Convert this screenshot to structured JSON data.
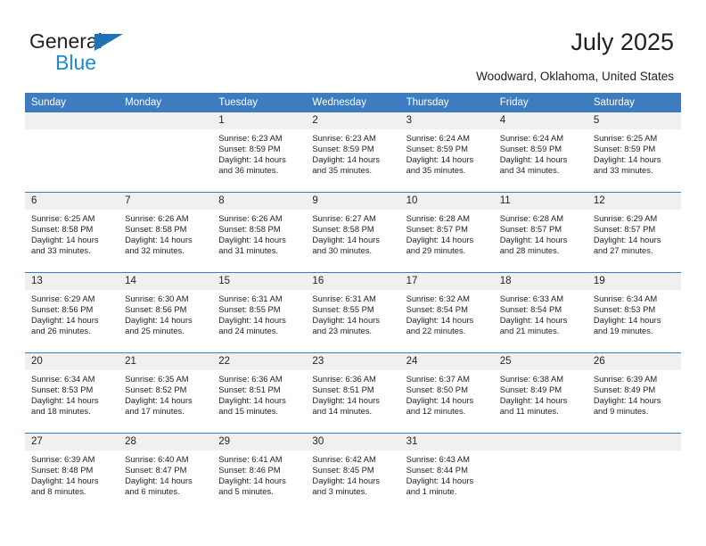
{
  "brand": {
    "line1": "General",
    "line2": "Blue",
    "triangle_icon": "brand-triangle-icon",
    "accent_color": "#1f8ad2"
  },
  "header": {
    "title": "July 2025",
    "subtitle": "Woodward, Oklahoma, United States"
  },
  "theme": {
    "header_row_bg": "#3d7cbf",
    "daynum_bg": "#f0f0f0",
    "text": "#231f20"
  },
  "weekday_headers": [
    "Sunday",
    "Monday",
    "Tuesday",
    "Wednesday",
    "Thursday",
    "Friday",
    "Saturday"
  ],
  "weeks": [
    [
      {
        "day": "",
        "empty": true,
        "sunrise": "",
        "sunset": "",
        "daylight_line1": "",
        "daylight_line2": ""
      },
      {
        "day": "",
        "empty": true,
        "sunrise": "",
        "sunset": "",
        "daylight_line1": "",
        "daylight_line2": ""
      },
      {
        "day": "1",
        "empty": false,
        "sunrise": "Sunrise: 6:23 AM",
        "sunset": "Sunset: 8:59 PM",
        "daylight_line1": "Daylight: 14 hours",
        "daylight_line2": "and 36 minutes."
      },
      {
        "day": "2",
        "empty": false,
        "sunrise": "Sunrise: 6:23 AM",
        "sunset": "Sunset: 8:59 PM",
        "daylight_line1": "Daylight: 14 hours",
        "daylight_line2": "and 35 minutes."
      },
      {
        "day": "3",
        "empty": false,
        "sunrise": "Sunrise: 6:24 AM",
        "sunset": "Sunset: 8:59 PM",
        "daylight_line1": "Daylight: 14 hours",
        "daylight_line2": "and 35 minutes."
      },
      {
        "day": "4",
        "empty": false,
        "sunrise": "Sunrise: 6:24 AM",
        "sunset": "Sunset: 8:59 PM",
        "daylight_line1": "Daylight: 14 hours",
        "daylight_line2": "and 34 minutes."
      },
      {
        "day": "5",
        "empty": false,
        "sunrise": "Sunrise: 6:25 AM",
        "sunset": "Sunset: 8:59 PM",
        "daylight_line1": "Daylight: 14 hours",
        "daylight_line2": "and 33 minutes."
      }
    ],
    [
      {
        "day": "6",
        "empty": false,
        "sunrise": "Sunrise: 6:25 AM",
        "sunset": "Sunset: 8:58 PM",
        "daylight_line1": "Daylight: 14 hours",
        "daylight_line2": "and 33 minutes."
      },
      {
        "day": "7",
        "empty": false,
        "sunrise": "Sunrise: 6:26 AM",
        "sunset": "Sunset: 8:58 PM",
        "daylight_line1": "Daylight: 14 hours",
        "daylight_line2": "and 32 minutes."
      },
      {
        "day": "8",
        "empty": false,
        "sunrise": "Sunrise: 6:26 AM",
        "sunset": "Sunset: 8:58 PM",
        "daylight_line1": "Daylight: 14 hours",
        "daylight_line2": "and 31 minutes."
      },
      {
        "day": "9",
        "empty": false,
        "sunrise": "Sunrise: 6:27 AM",
        "sunset": "Sunset: 8:58 PM",
        "daylight_line1": "Daylight: 14 hours",
        "daylight_line2": "and 30 minutes."
      },
      {
        "day": "10",
        "empty": false,
        "sunrise": "Sunrise: 6:28 AM",
        "sunset": "Sunset: 8:57 PM",
        "daylight_line1": "Daylight: 14 hours",
        "daylight_line2": "and 29 minutes."
      },
      {
        "day": "11",
        "empty": false,
        "sunrise": "Sunrise: 6:28 AM",
        "sunset": "Sunset: 8:57 PM",
        "daylight_line1": "Daylight: 14 hours",
        "daylight_line2": "and 28 minutes."
      },
      {
        "day": "12",
        "empty": false,
        "sunrise": "Sunrise: 6:29 AM",
        "sunset": "Sunset: 8:57 PM",
        "daylight_line1": "Daylight: 14 hours",
        "daylight_line2": "and 27 minutes."
      }
    ],
    [
      {
        "day": "13",
        "empty": false,
        "sunrise": "Sunrise: 6:29 AM",
        "sunset": "Sunset: 8:56 PM",
        "daylight_line1": "Daylight: 14 hours",
        "daylight_line2": "and 26 minutes."
      },
      {
        "day": "14",
        "empty": false,
        "sunrise": "Sunrise: 6:30 AM",
        "sunset": "Sunset: 8:56 PM",
        "daylight_line1": "Daylight: 14 hours",
        "daylight_line2": "and 25 minutes."
      },
      {
        "day": "15",
        "empty": false,
        "sunrise": "Sunrise: 6:31 AM",
        "sunset": "Sunset: 8:55 PM",
        "daylight_line1": "Daylight: 14 hours",
        "daylight_line2": "and 24 minutes."
      },
      {
        "day": "16",
        "empty": false,
        "sunrise": "Sunrise: 6:31 AM",
        "sunset": "Sunset: 8:55 PM",
        "daylight_line1": "Daylight: 14 hours",
        "daylight_line2": "and 23 minutes."
      },
      {
        "day": "17",
        "empty": false,
        "sunrise": "Sunrise: 6:32 AM",
        "sunset": "Sunset: 8:54 PM",
        "daylight_line1": "Daylight: 14 hours",
        "daylight_line2": "and 22 minutes."
      },
      {
        "day": "18",
        "empty": false,
        "sunrise": "Sunrise: 6:33 AM",
        "sunset": "Sunset: 8:54 PM",
        "daylight_line1": "Daylight: 14 hours",
        "daylight_line2": "and 21 minutes."
      },
      {
        "day": "19",
        "empty": false,
        "sunrise": "Sunrise: 6:34 AM",
        "sunset": "Sunset: 8:53 PM",
        "daylight_line1": "Daylight: 14 hours",
        "daylight_line2": "and 19 minutes."
      }
    ],
    [
      {
        "day": "20",
        "empty": false,
        "sunrise": "Sunrise: 6:34 AM",
        "sunset": "Sunset: 8:53 PM",
        "daylight_line1": "Daylight: 14 hours",
        "daylight_line2": "and 18 minutes."
      },
      {
        "day": "21",
        "empty": false,
        "sunrise": "Sunrise: 6:35 AM",
        "sunset": "Sunset: 8:52 PM",
        "daylight_line1": "Daylight: 14 hours",
        "daylight_line2": "and 17 minutes."
      },
      {
        "day": "22",
        "empty": false,
        "sunrise": "Sunrise: 6:36 AM",
        "sunset": "Sunset: 8:51 PM",
        "daylight_line1": "Daylight: 14 hours",
        "daylight_line2": "and 15 minutes."
      },
      {
        "day": "23",
        "empty": false,
        "sunrise": "Sunrise: 6:36 AM",
        "sunset": "Sunset: 8:51 PM",
        "daylight_line1": "Daylight: 14 hours",
        "daylight_line2": "and 14 minutes."
      },
      {
        "day": "24",
        "empty": false,
        "sunrise": "Sunrise: 6:37 AM",
        "sunset": "Sunset: 8:50 PM",
        "daylight_line1": "Daylight: 14 hours",
        "daylight_line2": "and 12 minutes."
      },
      {
        "day": "25",
        "empty": false,
        "sunrise": "Sunrise: 6:38 AM",
        "sunset": "Sunset: 8:49 PM",
        "daylight_line1": "Daylight: 14 hours",
        "daylight_line2": "and 11 minutes."
      },
      {
        "day": "26",
        "empty": false,
        "sunrise": "Sunrise: 6:39 AM",
        "sunset": "Sunset: 8:49 PM",
        "daylight_line1": "Daylight: 14 hours",
        "daylight_line2": "and 9 minutes."
      }
    ],
    [
      {
        "day": "27",
        "empty": false,
        "sunrise": "Sunrise: 6:39 AM",
        "sunset": "Sunset: 8:48 PM",
        "daylight_line1": "Daylight: 14 hours",
        "daylight_line2": "and 8 minutes."
      },
      {
        "day": "28",
        "empty": false,
        "sunrise": "Sunrise: 6:40 AM",
        "sunset": "Sunset: 8:47 PM",
        "daylight_line1": "Daylight: 14 hours",
        "daylight_line2": "and 6 minutes."
      },
      {
        "day": "29",
        "empty": false,
        "sunrise": "Sunrise: 6:41 AM",
        "sunset": "Sunset: 8:46 PM",
        "daylight_line1": "Daylight: 14 hours",
        "daylight_line2": "and 5 minutes."
      },
      {
        "day": "30",
        "empty": false,
        "sunrise": "Sunrise: 6:42 AM",
        "sunset": "Sunset: 8:45 PM",
        "daylight_line1": "Daylight: 14 hours",
        "daylight_line2": "and 3 minutes."
      },
      {
        "day": "31",
        "empty": false,
        "sunrise": "Sunrise: 6:43 AM",
        "sunset": "Sunset: 8:44 PM",
        "daylight_line1": "Daylight: 14 hours",
        "daylight_line2": "and 1 minute."
      },
      {
        "day": "",
        "empty": true,
        "sunrise": "",
        "sunset": "",
        "daylight_line1": "",
        "daylight_line2": ""
      },
      {
        "day": "",
        "empty": true,
        "sunrise": "",
        "sunset": "",
        "daylight_line1": "",
        "daylight_line2": ""
      }
    ]
  ]
}
